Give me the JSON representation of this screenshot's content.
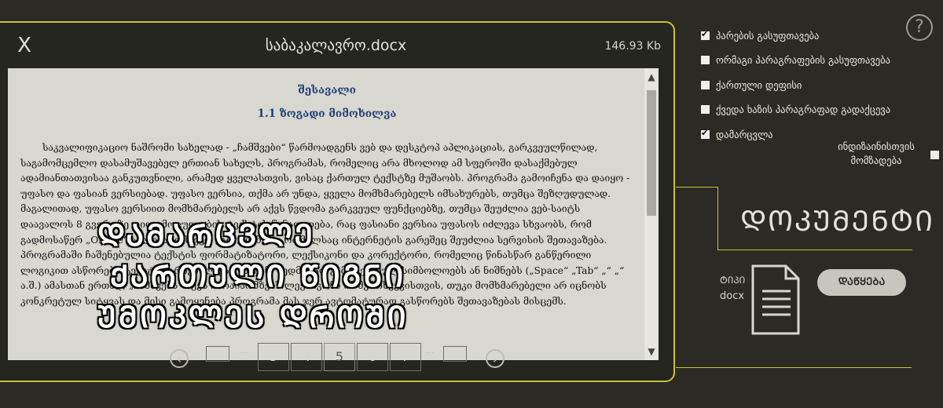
{
  "viewer": {
    "close_label": "X",
    "title": "საბაკალავრო.docx",
    "file_size": "146.93 Kb",
    "heading": "შესავალი",
    "subheading": "1.1 ზოგადი მიმოხილვა",
    "body": "საკვალიფიკაციო ნაშრომი სახელად - „ჩამშვები“ წარმოადგენს ვებ და დესკტოპ აპლიკაციას, გარკვეულწილად, საგამომცემლო დასამუშავებელ ერთიან სახელს, პროგრამას, რომელიც არა მხოლოდ ამ სფეროში დასაქმებულ ადამიანთათვისაა განკუთვნილი, არამედ ყველასთვის, ვისაც ქართულ ტექსტზე მუშაობს. პროგრამა გამოიჩენა და დაიყო - უფასო და ფასიან ვერსიებად. უფასო ვერსია, თქმა არ უნდა, ყველა მომხმარებელს იმსახურებს, თუმცა შეზღუდულად. მაგალითად, უფასო ვერსიით მომხმარებელს არ აქვს წვდომა გარკვეულ ფუნქციებზე, თუმცა შეუძლია ვებ-საიტს დაავალოს 8 გვერდზე დიდი მოცულობის ტექსტის წინადადება, რაც ფასიანი ვერსია უფასოს იძლევა სხვაობს, რომ გადმოსაწერ „Offline“ აპლიკაციას ვერ გამოიყენებს. რომელსაც ინტერნეტის გარეშეც შეუძლია სერვისის შეთავაზება. პროგრამაში ჩაშენებულია ტექსტის ფორმატიზატორი, ლექსიკონი და კორექტორი, რომელიც წინასწარ განწერილი ლოგიკით ასწორებს ტექსტში არსებულ გამოსაჩენ, ზედმეტად გამოყენებულ სიმბოლოებს ან ნიშნებს („Space“ „Tab“ „“ „“ ა.შ.) ამასთან ერთად, „ჩამშვებს“ აქვს ჩარაიარმზებს ლექსიკონი იმ შემთხვევისთვის, თუკი მომხმარებელი არ იცნობს კონკრეტულ სიტყვას და მისი გამოყენება პროგრამა მას ჯერ ავტომატურად გასწორებს შეთავაზებას მისცემს."
  },
  "overlay": {
    "line1": "ᲓᲐᲛᲐᲠᲪᲕᲚᲔ",
    "line2": "ᲥᲐᲠᲗᲣᲚᲘ ᲬᲘᲒᲜᲘ",
    "line3": "ᲣᲛᲝᲙᲚᲔᲡ ᲓᲠᲝᲨᲘ"
  },
  "pagination": {
    "first": "1",
    "ellipsis": "...",
    "pages": [
      "3",
      "4",
      "5",
      "6",
      "7"
    ],
    "current": "5",
    "last": "9",
    "prev_icon": "chevron-left-icon",
    "next_icon": "chevron-right-icon"
  },
  "options": {
    "items": [
      {
        "label": "პარების გასუფთავება",
        "checked": true
      },
      {
        "label": "ორმაგი პარაგრაფების გასუფთავება",
        "checked": false
      },
      {
        "label": "ქართული დეფისი",
        "checked": false
      },
      {
        "label": "ქვედა ხაზის პარაგრაფად გადაქცევა",
        "checked": false
      },
      {
        "label": "დამარცვლა",
        "checked": true
      }
    ],
    "print_label": "ინდიზაინისთვის მომზადება",
    "print_checked": false
  },
  "document_panel": {
    "title": "ᲓᲝᲙᲣᲛᲔᲜᲢᲘ",
    "type_label": "ᲢᲘᲞᲘ",
    "type_value": "docx",
    "download_label": "ᲓᲐᲬᲧᲔᲑᲐ"
  },
  "colors": {
    "accent": "#c9c23a",
    "background": "#2b2a24",
    "heading_blue": "#1f3e78"
  }
}
